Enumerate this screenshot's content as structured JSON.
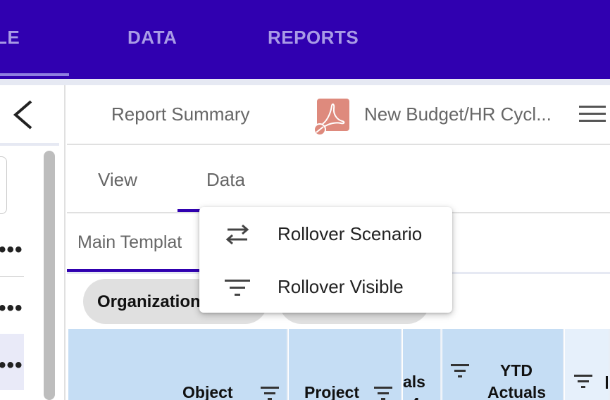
{
  "topnav": {
    "items": [
      {
        "label": "LE"
      },
      {
        "label": "DATA"
      },
      {
        "label": "REPORTS"
      }
    ]
  },
  "report": {
    "summary_label": "Report Summary",
    "title": "New Budget/HR Cycl..."
  },
  "tabs": [
    {
      "label": "View"
    },
    {
      "label": "Data"
    }
  ],
  "template_tab": {
    "label": "Main Templat"
  },
  "chips": [
    {
      "label": "Organization"
    }
  ],
  "table": {
    "columns": [
      {
        "label": "Object"
      },
      {
        "label": "Project"
      },
      {
        "label": "als"
      },
      {
        "label_line1": "YTD",
        "label_line2": "Actuals"
      }
    ]
  },
  "dropdown": {
    "items": [
      {
        "label": "Rollover Scenario",
        "icon": "swap-arrows-icon"
      },
      {
        "label": "Rollover Visible",
        "icon": "filter-icon"
      }
    ]
  },
  "colors": {
    "brand": "#3000b0",
    "table_header": "#c5ddf4",
    "chip": "#e0e0e0"
  }
}
